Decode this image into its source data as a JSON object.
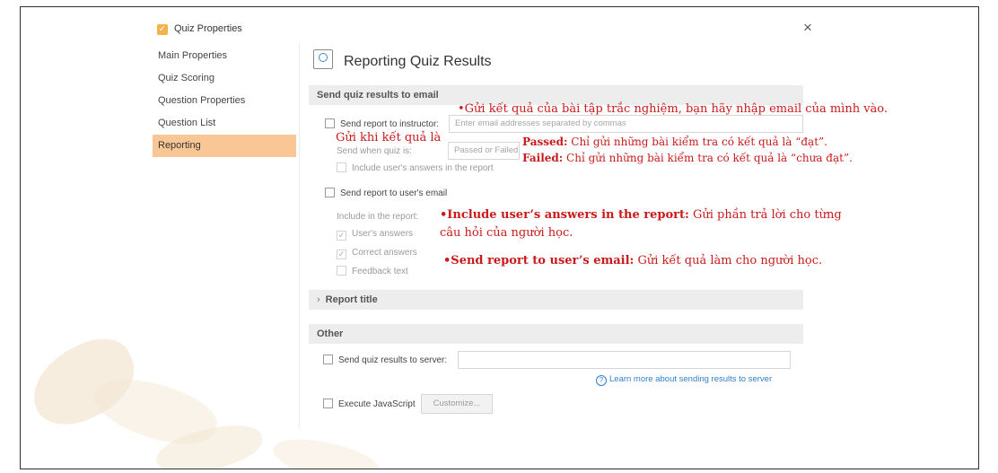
{
  "window": {
    "title": "Quiz Properties",
    "close_glyph": "×"
  },
  "sidebar": {
    "items": [
      {
        "label": "Main Properties"
      },
      {
        "label": "Quiz Scoring"
      },
      {
        "label": "Question Properties"
      },
      {
        "label": "Question List"
      },
      {
        "label": "Reporting"
      }
    ],
    "active": "Reporting"
  },
  "page": {
    "title": "Reporting Quiz Results"
  },
  "email_section": {
    "header": "Send quiz results to email",
    "instructor": {
      "label": "Send report to instructor:",
      "placeholder": "Enter email addresses separated by commas",
      "send_when_label": "Send when quiz is:",
      "send_when_value": "Passed or Failed",
      "include_answers_label": "Include user's answers in the report"
    },
    "user": {
      "label": "Send report to user's email",
      "include_label": "Include in the report:",
      "options": [
        {
          "label": "User's answers",
          "checked": true
        },
        {
          "label": "Correct answers",
          "checked": true
        },
        {
          "label": "Feedback text",
          "checked": false
        }
      ]
    },
    "report_title": "Report title"
  },
  "other_section": {
    "header": "Other",
    "server_label": "Send quiz results to server:",
    "server_value": "",
    "learn_more": "Learn more about sending results to server",
    "js_label": "Execute JavaScript",
    "customize_label": "Customize..."
  },
  "annotations": {
    "email_note": "•Gửi kết quả của bài tập trắc nghiệm, bạn hãy nhập email của mình vào.",
    "send_when_note": "Gửi khi kết quả là",
    "passed_term": "Passed:",
    "passed_desc": " Chỉ gửi những bài kiểm tra có kết quả là “đạt”.",
    "failed_term": "Failed:",
    "failed_desc": " Chỉ gửi những bài kiểm tra có kết quả là “chưa đạt”.",
    "include_term": "•Include user’s answers in the report:",
    "include_desc_1": " Gửi phần trả lời cho từng",
    "include_desc_2": "câu hỏi của người học.",
    "send_user_term": "•Send report to user’s email:",
    "send_user_desc": " Gửi kết quả làm cho người học."
  },
  "colors": {
    "accent_active": "#f9c796",
    "annotation": "#c91a1a",
    "link": "#2f7fcf",
    "app_icon": "#f4b24d"
  }
}
